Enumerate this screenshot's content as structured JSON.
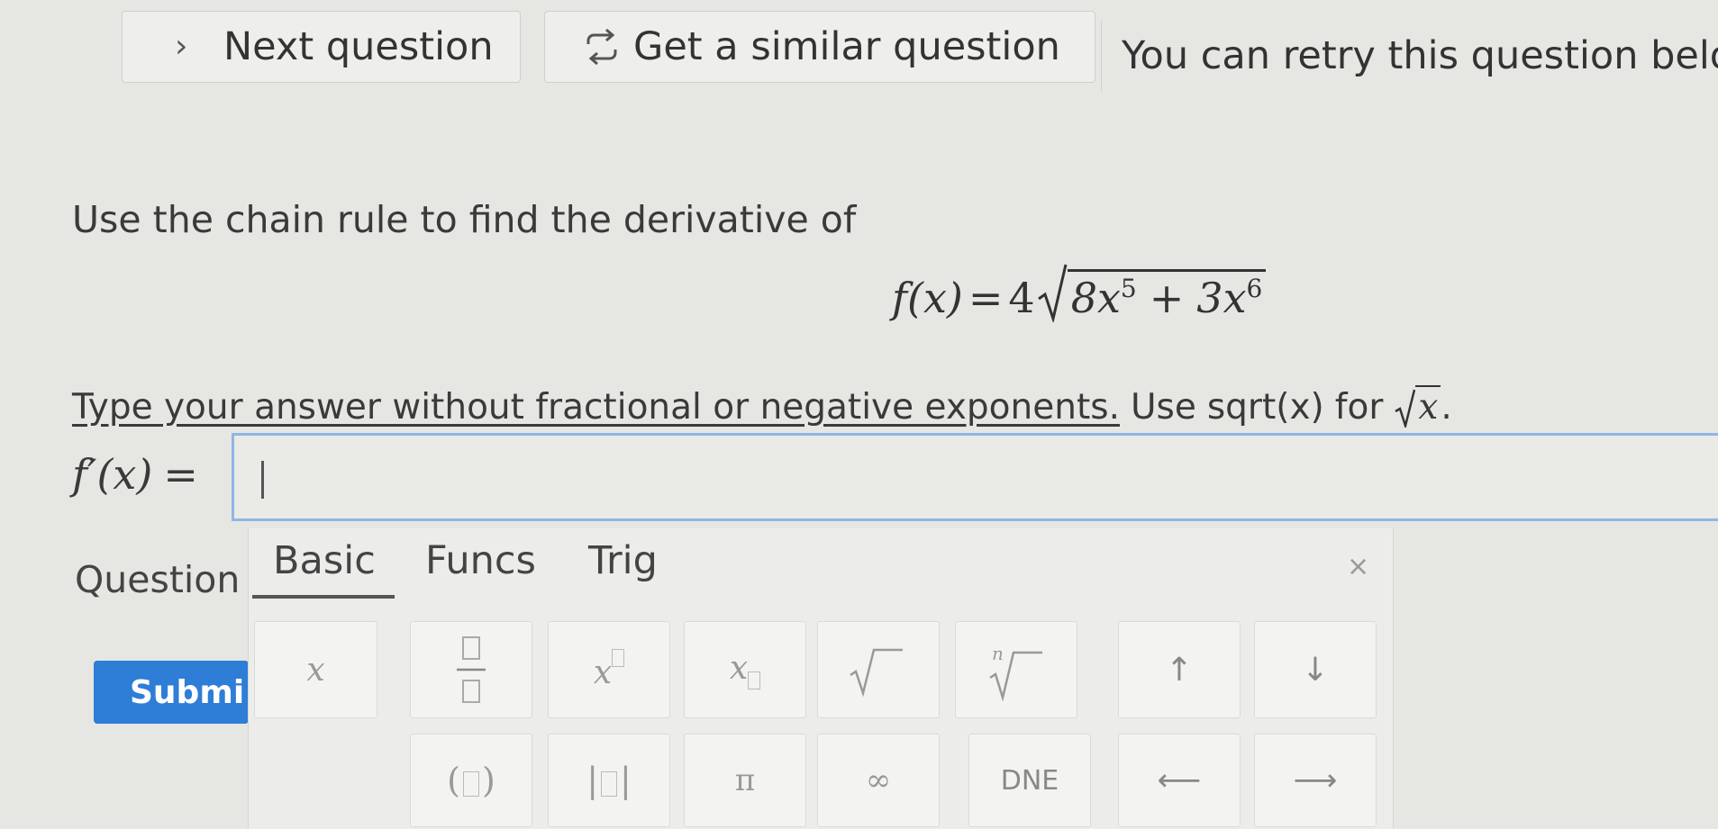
{
  "toolbar": {
    "next_label": "Next question",
    "similar_label": "Get a similar question",
    "retry_text": "You can retry this question belov"
  },
  "question": {
    "prompt": "Use the chain rule to find the derivative of",
    "fx_lhs": "f(x)",
    "fx_equals": "=",
    "fx_coef": "4",
    "radicand_a": "8x",
    "exp_a": "5",
    "plus": "+",
    "radicand_b": "3x",
    "exp_b": "6"
  },
  "instructions": {
    "underlined": "Type your answer without fractional or negative exponents.",
    "use_word": "Use",
    "sqrt_code": "sqrt(x)",
    "for_word": "for",
    "sqrt_arg": "x",
    "period": "."
  },
  "answer": {
    "label": "f′(x)",
    "equals": "=",
    "value": ""
  },
  "side": {
    "question_label": "Question",
    "submit_label": "Submi"
  },
  "keypad": {
    "tabs": [
      "Basic",
      "Funcs",
      "Trig"
    ],
    "active_tab": "Basic",
    "close_symbol": "×",
    "row1": [
      "x",
      "□/□",
      "x□",
      "x□",
      "√□",
      "ⁿ√□",
      "↑",
      "↓"
    ],
    "row2": [
      "(□)",
      "|□|",
      "π",
      "∞",
      "DNE",
      "⟵",
      "⟶"
    ]
  },
  "colors": {
    "accent": "#2e7dd7",
    "input_border": "#8fb6e3",
    "background": "#e6e6e3"
  }
}
